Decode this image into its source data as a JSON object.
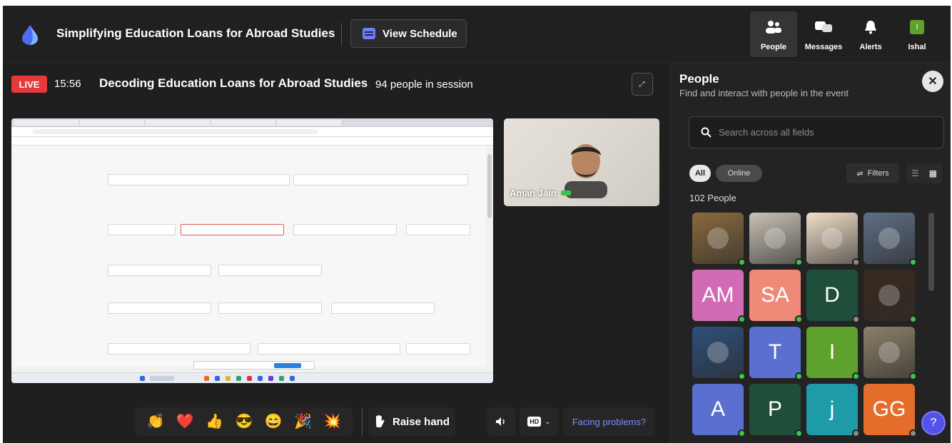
{
  "header": {
    "event_title": "Simplifying Education Loans for Abroad Studies",
    "schedule_label": "View Schedule",
    "nav": [
      {
        "label": "People",
        "icon": "people-icon",
        "active": true
      },
      {
        "label": "Messages",
        "icon": "messages-icon",
        "active": false
      },
      {
        "label": "Alerts",
        "icon": "bell-icon",
        "active": false
      },
      {
        "label": "Ishal",
        "icon": "avatar",
        "initial": "I",
        "active": false
      }
    ]
  },
  "stage": {
    "live_label": "LIVE",
    "elapsed": "15:56",
    "session_title": "Decoding Education Loans for Abroad Studies",
    "session_count": "94 people in session",
    "speaker_name": "Aman Jain"
  },
  "controls": {
    "reactions": [
      "👏",
      "❤️",
      "👍",
      "😎",
      "😄",
      "🎉",
      "💥"
    ],
    "raise_hand_label": "Raise hand",
    "hd_label": "HD",
    "facing_problems_label": "Facing problems?"
  },
  "panel": {
    "title": "People",
    "subtitle": "Find and interact with people in the event",
    "search_placeholder": "Search across all fields",
    "filter_all": "All",
    "filter_online": "Online",
    "filters_label": "Filters",
    "count_label": "102 People",
    "tiles": [
      {
        "type": "photo",
        "color": "#8a6a3d",
        "status": "online"
      },
      {
        "type": "photo",
        "color": "#c9c1b4",
        "status": "online"
      },
      {
        "type": "photo",
        "color": "#f1dfc8",
        "status": "offline"
      },
      {
        "type": "photo",
        "color": "#5f6f84",
        "status": "online"
      },
      {
        "type": "initials",
        "text": "AM",
        "color": "#d16bb5",
        "status": "online"
      },
      {
        "type": "initials",
        "text": "SA",
        "color": "#ef8a78",
        "status": "online"
      },
      {
        "type": "initials",
        "text": "D",
        "color": "#1f4e3b",
        "status": "offline"
      },
      {
        "type": "photo",
        "color": "#3a2a1e",
        "status": "online"
      },
      {
        "type": "photo",
        "color": "#2d4f7a",
        "status": "online"
      },
      {
        "type": "initials",
        "text": "T",
        "color": "#5a6fcf",
        "status": "online"
      },
      {
        "type": "initials",
        "text": "I",
        "color": "#5fa12d",
        "status": "online"
      },
      {
        "type": "photo",
        "color": "#8c8168",
        "status": "online"
      },
      {
        "type": "initials",
        "text": "A",
        "color": "#5a6fcf",
        "status": "online"
      },
      {
        "type": "initials",
        "text": "P",
        "color": "#1f4e3b",
        "status": "online"
      },
      {
        "type": "initials",
        "text": "j",
        "color": "#1f9aa8",
        "status": "offline"
      },
      {
        "type": "initials",
        "text": "GG",
        "color": "#e46d2c",
        "status": "offline"
      }
    ],
    "help_label": "?"
  }
}
